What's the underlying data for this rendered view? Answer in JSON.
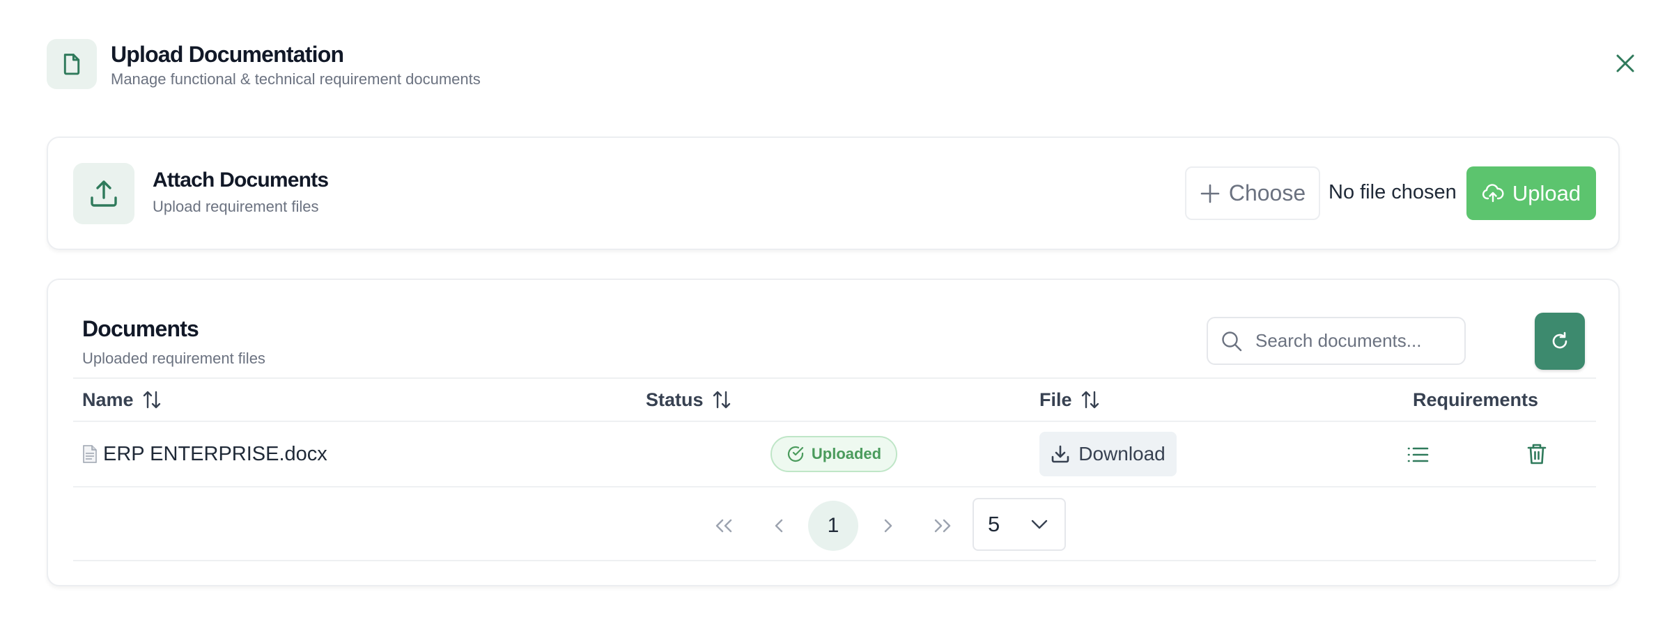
{
  "header": {
    "title": "Upload Documentation",
    "subtitle": "Manage functional & technical requirement documents",
    "icon": "document-icon"
  },
  "attach": {
    "title": "Attach Documents",
    "subtitle": "Upload requirement files",
    "choose_label": "Choose",
    "file_status": "No file chosen",
    "upload_label": "Upload"
  },
  "documents": {
    "title": "Documents",
    "subtitle": "Uploaded requirement files",
    "search_placeholder": "Search documents...",
    "columns": {
      "name": "Name",
      "status": "Status",
      "file": "File",
      "requirements": "Requirements"
    },
    "rows": [
      {
        "name": "ERP ENTERPRISE.docx",
        "status": "Uploaded",
        "file_action": "Download"
      }
    ]
  },
  "pagination": {
    "current_page": "1",
    "page_size": "5"
  },
  "colors": {
    "primary_green": "#5cc46e",
    "dark_green": "#3d8a6e",
    "icon_green": "#2f7a5b",
    "status_text": "#4a9b5c"
  }
}
